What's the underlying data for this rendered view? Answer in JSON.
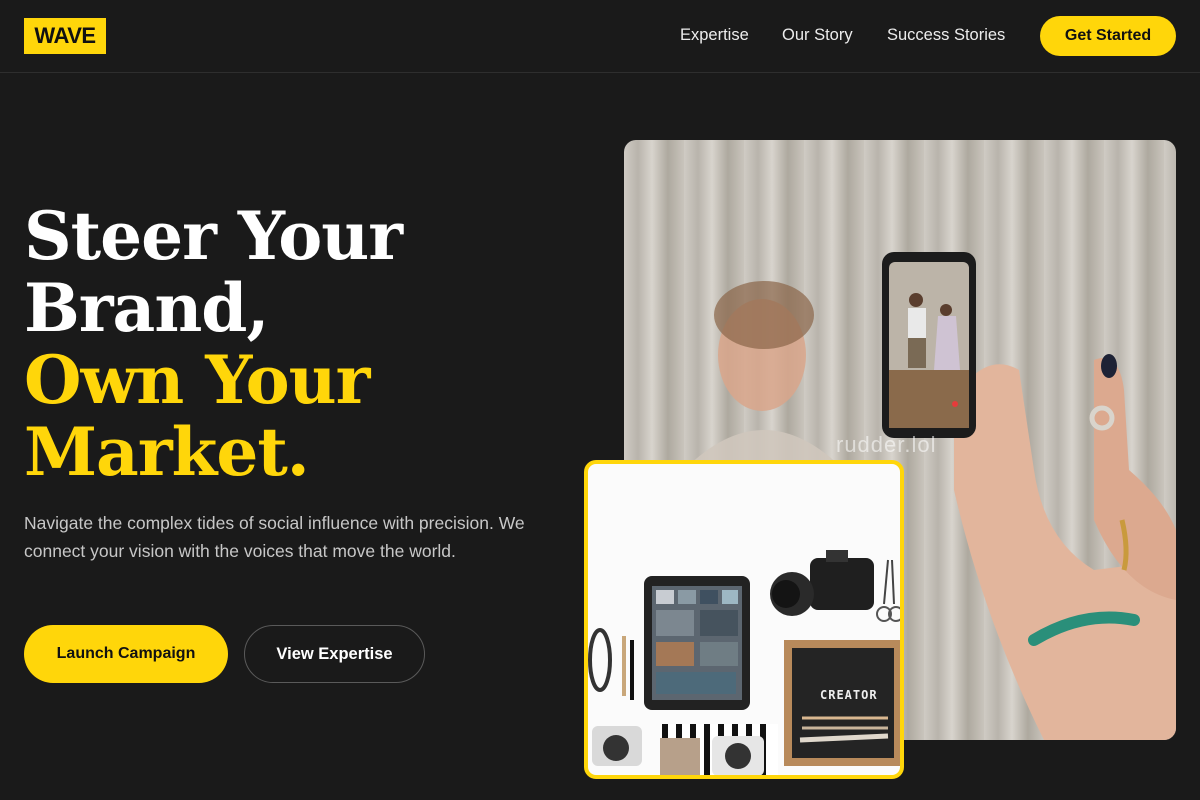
{
  "header": {
    "logo": "WAVE",
    "nav": [
      {
        "label": "Expertise"
      },
      {
        "label": "Our Story"
      },
      {
        "label": "Success Stories"
      }
    ],
    "cta_label": "Get Started"
  },
  "hero": {
    "headline_white": [
      "Steer Your",
      "Brand,"
    ],
    "headline_yellow": [
      "Own Your",
      "Market."
    ],
    "subtext": "Navigate the complex tides of social influence with precision. We connect your vision with the voices that move the world.",
    "primary_button": "Launch Campaign",
    "secondary_button": "View Expertise"
  },
  "images": {
    "main_watermark": "rudder.lol",
    "inset_sign_text": "CREATOR"
  },
  "colors": {
    "background": "#1a1a1a",
    "accent": "#ffd60a",
    "text": "#ffffff",
    "muted_text": "#c7c7c7"
  }
}
